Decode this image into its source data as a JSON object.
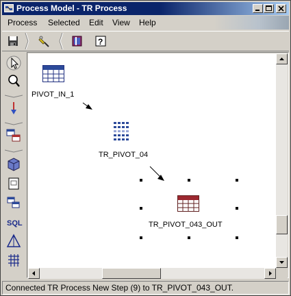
{
  "window": {
    "title": "Process Model - TR Process"
  },
  "menubar": {
    "items": [
      {
        "label": "Process"
      },
      {
        "label": "Selected"
      },
      {
        "label": "Edit"
      },
      {
        "label": "View"
      },
      {
        "label": "Help"
      }
    ]
  },
  "toolbar": {
    "tools": [
      "save-icon",
      "highlighter-icon",
      "book-icon",
      "help-icon"
    ]
  },
  "palette": {
    "tools": [
      "select-arrow-icon",
      "zoom-icon",
      "connect-arrow-icon",
      "table-objects-icon",
      "cube-icon",
      "file-icon",
      "multi-table-icon",
      "sql-icon",
      "pyramid-icon",
      "grid-icon"
    ]
  },
  "canvas": {
    "nodes": [
      {
        "label": "PIVOT_IN_1",
        "icon": "table-icon"
      },
      {
        "label": "TR_PIVOT_04",
        "icon": "pivot-step-icon"
      },
      {
        "label": "TR_PIVOT_043_OUT",
        "icon": "table-icon",
        "selected": true
      }
    ]
  },
  "status": {
    "text": "Connected TR Process New Step (9) to TR_PIVOT_043_OUT."
  },
  "colors": {
    "title_start": "#0a246a",
    "title_end": "#a6caf0",
    "chrome": "#d4d0c8",
    "table_header": "#2c4a9a",
    "table_header_out": "#9c2830"
  }
}
